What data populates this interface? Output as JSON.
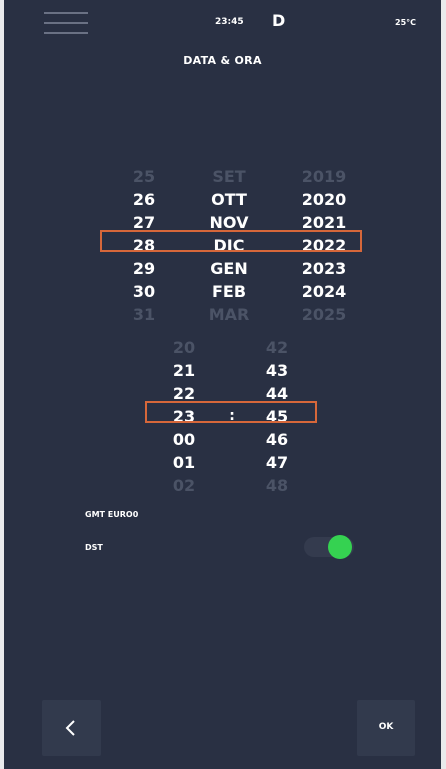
{
  "status_bar": {
    "time": "23:45",
    "logo": "D",
    "temperature": "25°C"
  },
  "header": {
    "title": "DATA & ORA",
    "menu_icon": "hamburger-menu-icon"
  },
  "date_picker": {
    "days": [
      "25",
      "26",
      "27",
      "28",
      "29",
      "30",
      "31"
    ],
    "months": [
      "SET",
      "OTT",
      "NOV",
      "DIC",
      "GEN",
      "FEB",
      "MAR"
    ],
    "years": [
      "2019",
      "2020",
      "2021",
      "2022",
      "2023",
      "2024",
      "2025"
    ],
    "selected": {
      "day": "28",
      "month": "DIC",
      "year": "2022"
    }
  },
  "time_picker": {
    "hours": [
      "20",
      "21",
      "22",
      "23",
      "00",
      "01",
      "02"
    ],
    "minutes": [
      "42",
      "43",
      "44",
      "45",
      "46",
      "47",
      "48"
    ],
    "separator": ":",
    "selected": {
      "hour": "23",
      "minute": "45"
    }
  },
  "settings": {
    "timezone_label": "GMT EURO0",
    "dst_label": "DST",
    "dst_enabled": true
  },
  "footer": {
    "back_icon": "chevron-left-icon",
    "ok_label": "OK"
  },
  "colors": {
    "background": "#293043",
    "selection_border": "#d6673a",
    "toggle_on": "#35d251",
    "button_bg": "#323a4d",
    "dim_text": "#4b5366"
  }
}
